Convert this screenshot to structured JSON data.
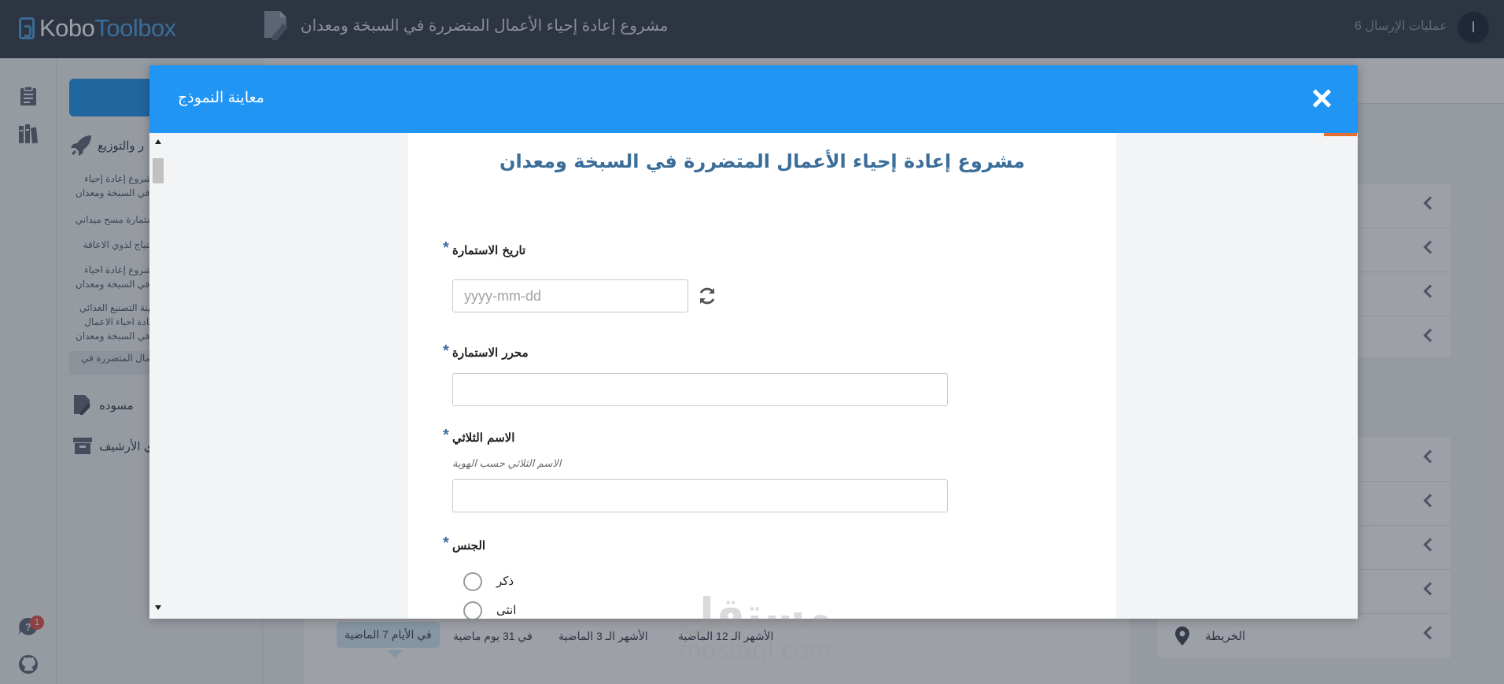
{
  "app": {
    "logo": {
      "part1": "Kobo",
      "part2": "Toolbox"
    },
    "project_title": "مشروع إعادة إحياء الأعمال المتضررة في السبخة ومعدان",
    "submissions_label": "عمليات الإرسال 6",
    "avatar_initial": "ا"
  },
  "rail": {
    "icons": [
      "projects-icon",
      "library-icon",
      "help-icon",
      "github-icon"
    ],
    "help_badge": "1"
  },
  "sidebar": {
    "deployed_label": "ر والتوزيع",
    "items": [
      "مشروع إعادة إحياء\nة في السبخة ومعدان",
      "استمارة مسح ميداني",
      "احتياج لذوي الاعاقة",
      "مشروع إعادة احياء\nة في السبخة ومعدان",
      "مهنة التصنيع الغذائي\nإعادة احياء الاعمال\nة في السبخة ومعدان",
      "اعمال المتضررة في"
    ],
    "draft_label": "مسوده",
    "archive_label": "ي الأرشيف"
  },
  "main": {
    "right_card_rows": 4,
    "right_card2": {
      "map_label": "الخريطة"
    },
    "range_tabs": [
      "في الأيام 7 الماضية",
      "في 31 يوم ماضية",
      "الأشهر الـ 3 الماضية",
      "الأشهر الـ 12 الماضية"
    ]
  },
  "modal": {
    "title": "معاينة النموذج",
    "form": {
      "title": "مشروع إعادة إحياء الأعمال المتضررة في السبخة ومعدان",
      "questions": [
        {
          "label": "تاريخ الاستمارة",
          "required": "*",
          "placeholder": "yyyy-mm-dd"
        },
        {
          "label": "محرر الاستمارة",
          "required": "*"
        },
        {
          "label": "الاسم الثلاثي",
          "required": "*",
          "hint": "الاسم الثلاثي حسب الهوية"
        },
        {
          "label": "الجنس",
          "required": "*",
          "options": [
            "ذكر",
            "انثى"
          ]
        }
      ]
    }
  },
  "watermark": {
    "arabic": "مستقل",
    "latin": "mostaql.com"
  },
  "colors": {
    "header": "#353c4a",
    "accent_blue": "#2095f3",
    "form_title": "#3c6e9a",
    "accent_orange": "#e96c30"
  }
}
